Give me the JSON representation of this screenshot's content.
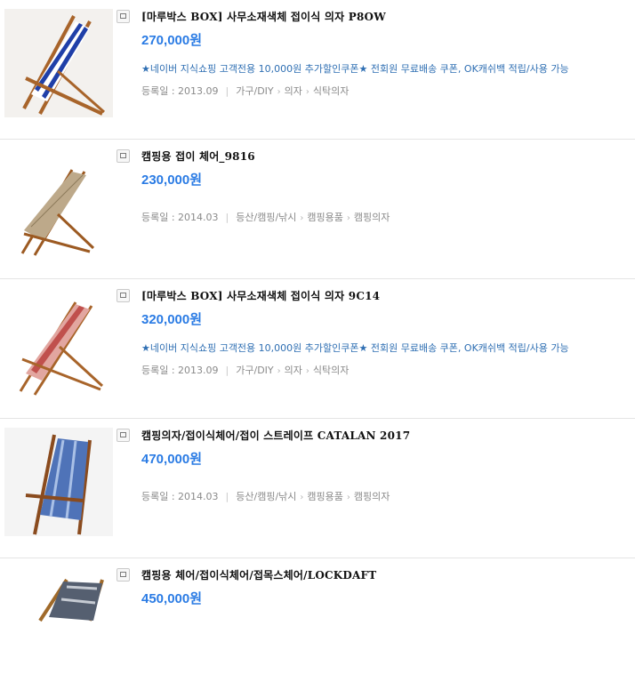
{
  "products": [
    {
      "title": "[마루박스 BOX] 사무소재색체 접이식 의자 P8OW",
      "price": "270,000원",
      "promo": "★네이버 지식쇼핑 고객전용 10,000원 추가할인쿠폰★ 전회원 무료배송 쿠폰, OK캐쉬백 적립/사용 가능",
      "date_label": "등록일 : 2013.09",
      "categories": [
        "가구/DIY",
        "의자",
        "식탁의자"
      ],
      "stripe_color": "#1f3fa8",
      "frame_color": "#a8642a"
    },
    {
      "title": "캠핑용 접이 체어_9816",
      "price": "230,000원",
      "promo": "",
      "date_label": "등록일 : 2014.03",
      "categories": [
        "등산/캠핑/낚시",
        "캠핑용품",
        "캠핑의자"
      ],
      "stripe_color": "#bda98a",
      "frame_color": "#9c5a22"
    },
    {
      "title": "[마루박스 BOX] 사무소재색체 접이식 의자 9C14",
      "price": "320,000원",
      "promo": "★네이버 지식쇼핑 고객전용 10,000원 추가할인쿠폰★ 전회원 무료배송 쿠폰, OK캐쉬백 적립/사용 가능",
      "date_label": "등록일 : 2013.09",
      "categories": [
        "가구/DIY",
        "의자",
        "식탁의자"
      ],
      "stripe_color": "#c0504d",
      "frame_color": "#a8642a"
    },
    {
      "title": "캠핑의자/접이식체어/접이 스트레이프 CATALAN 2017",
      "price": "470,000원",
      "promo": "",
      "date_label": "등록일 : 2014.03",
      "categories": [
        "등산/캠핑/낚시",
        "캠핑용품",
        "캠핑의자"
      ],
      "stripe_color": "#4f73b8",
      "frame_color": "#8a4b1e"
    },
    {
      "title": "캠핑용 체어/접이식체어/접목스체어/LOCKDAFT",
      "price": "450,000원",
      "promo": "",
      "date_label": "",
      "categories": [],
      "stripe_color": "#555f70",
      "frame_color": "#a06a2a"
    }
  ]
}
